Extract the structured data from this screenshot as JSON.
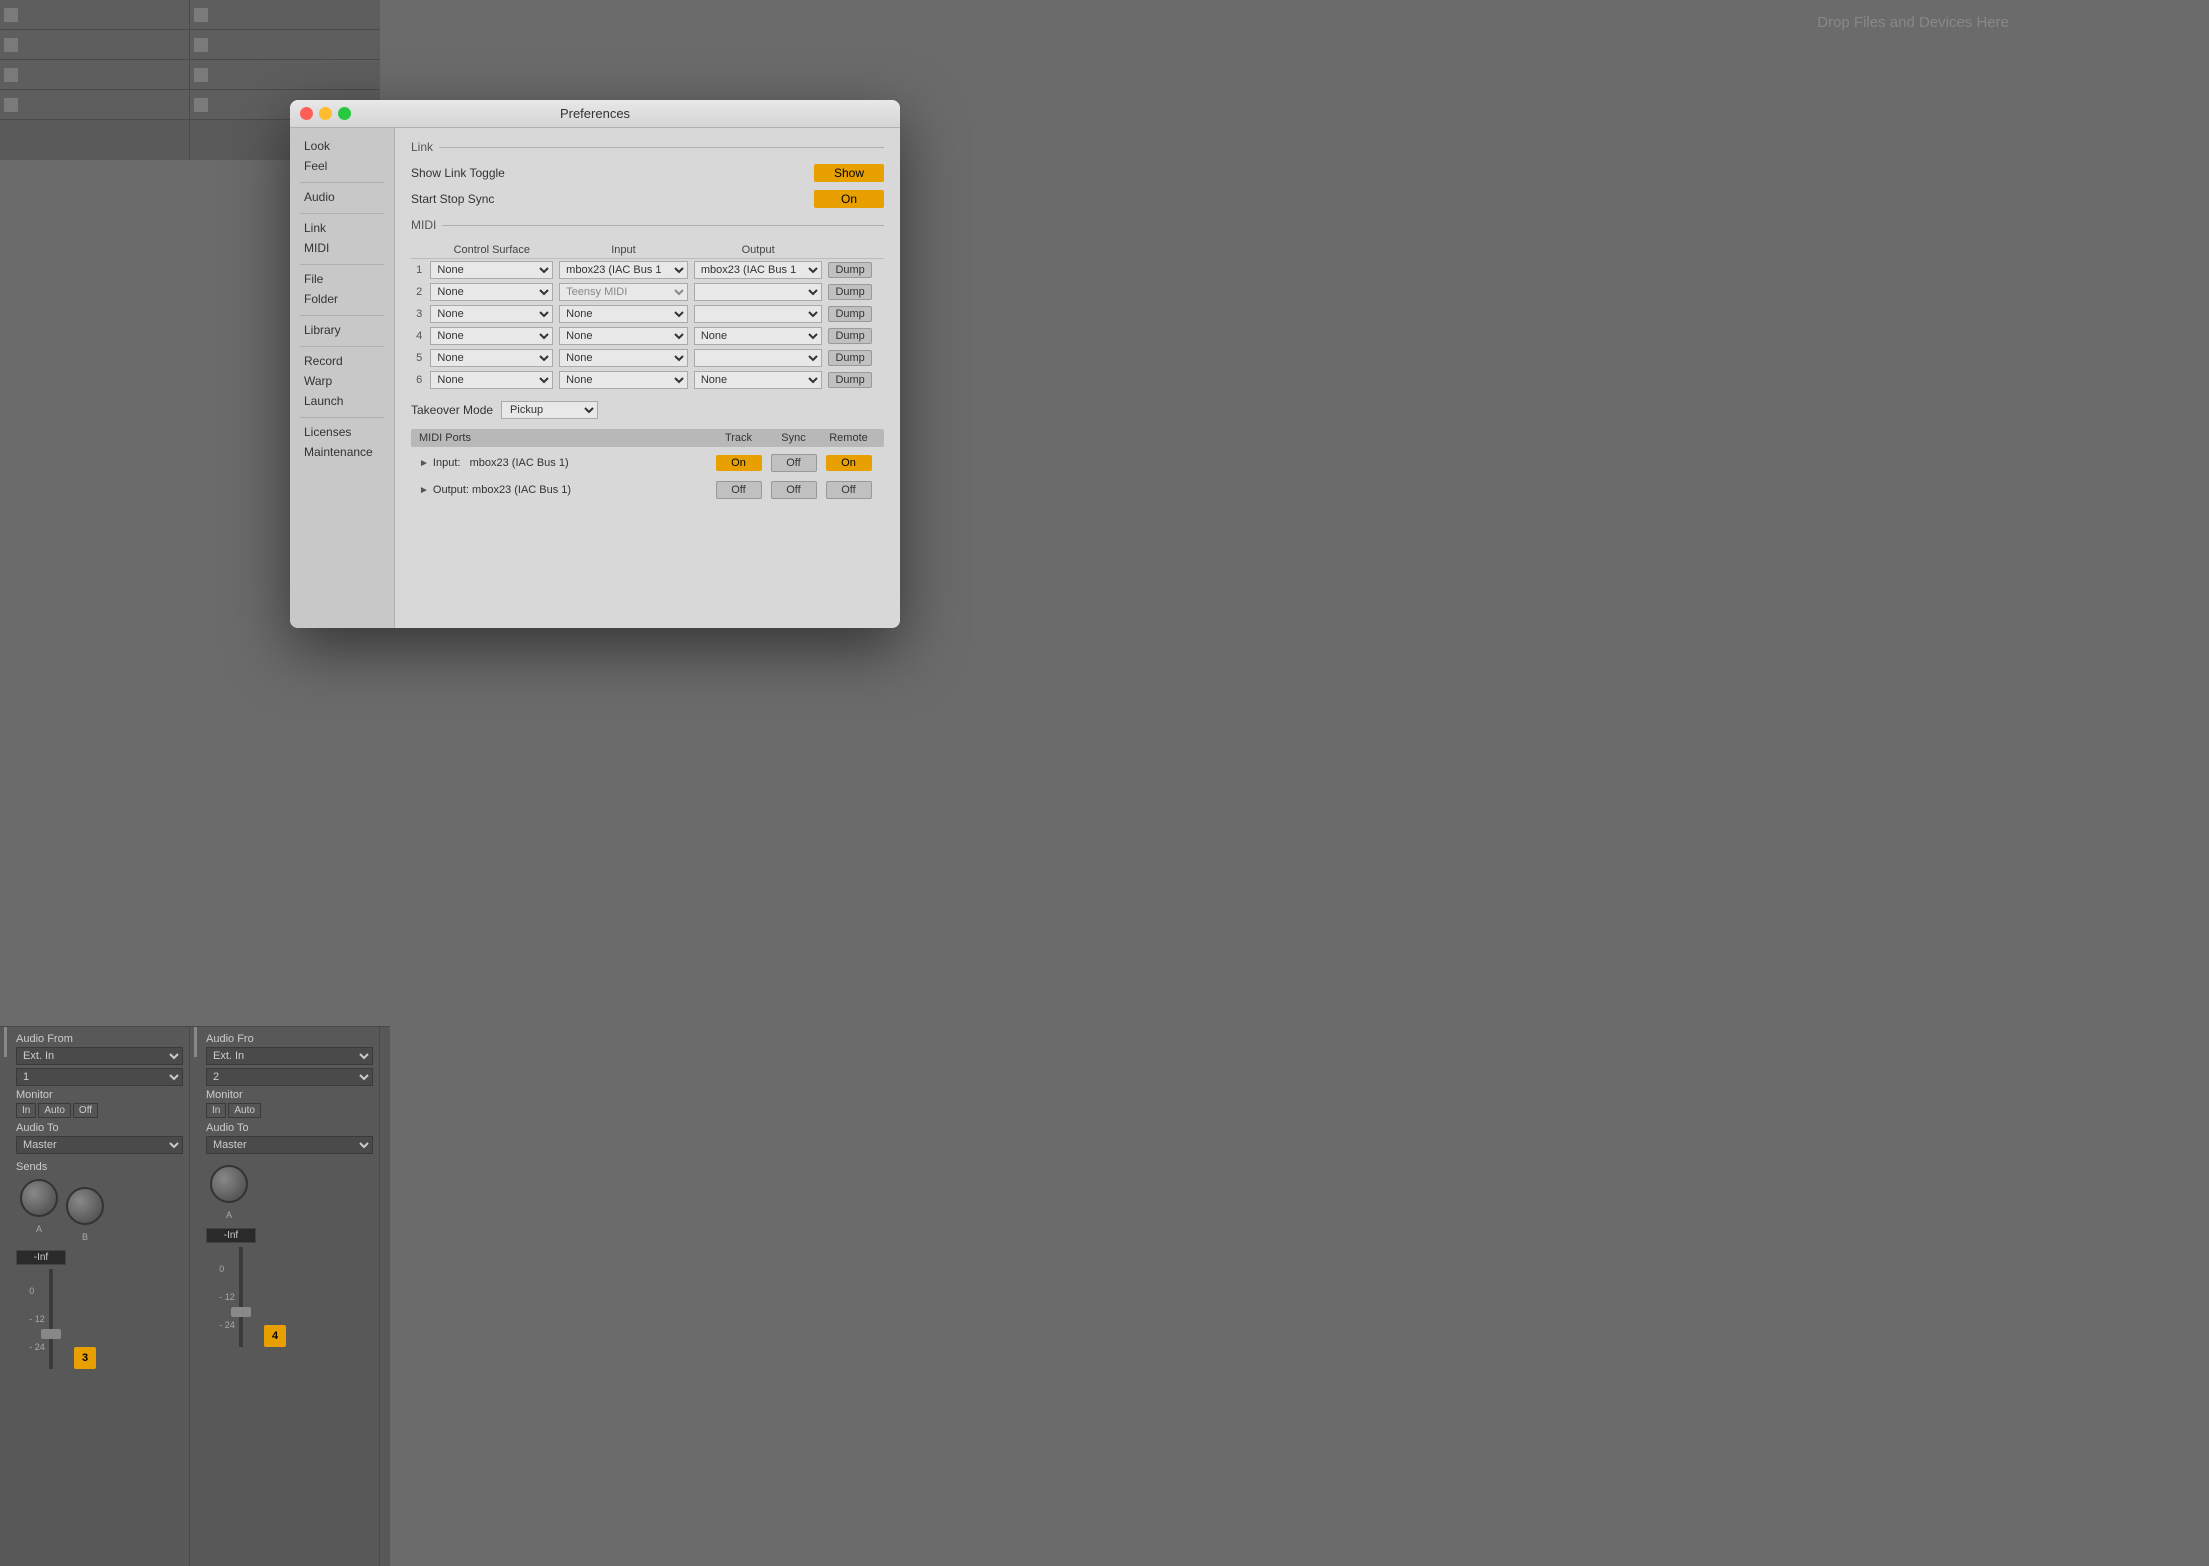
{
  "app": {
    "drop_zone_text": "Drop Files and Devices Here"
  },
  "preferences": {
    "title": "Preferences",
    "window_buttons": {
      "close": "close",
      "minimize": "minimize",
      "maximize": "maximize"
    },
    "sidebar": {
      "items": [
        {
          "id": "look",
          "label": "Look"
        },
        {
          "id": "feel",
          "label": "Feel"
        },
        {
          "id": "audio",
          "label": "Audio"
        },
        {
          "id": "link",
          "label": "Link"
        },
        {
          "id": "midi",
          "label": "MIDI"
        },
        {
          "id": "file",
          "label": "File"
        },
        {
          "id": "folder",
          "label": "Folder"
        },
        {
          "id": "library",
          "label": "Library"
        },
        {
          "id": "record",
          "label": "Record"
        },
        {
          "id": "warp",
          "label": "Warp"
        },
        {
          "id": "launch",
          "label": "Launch"
        },
        {
          "id": "licenses",
          "label": "Licenses"
        },
        {
          "id": "maintenance",
          "label": "Maintenance"
        }
      ]
    },
    "content": {
      "link_section_label": "Link",
      "show_link_toggle_label": "Show Link Toggle",
      "show_link_toggle_value": "Show",
      "start_stop_sync_label": "Start Stop Sync",
      "start_stop_sync_value": "On",
      "midi_section_label": "MIDI",
      "midi_table": {
        "headers": [
          "Control Surface",
          "Input",
          "Output",
          ""
        ],
        "rows": [
          {
            "num": "1",
            "surface": "None",
            "input": "mbox23 (IAC Bus 1",
            "output": "mbox23 (IAC Bus 1",
            "dump": "Dump"
          },
          {
            "num": "2",
            "surface": "None",
            "input": "Teensy MIDI",
            "output": "",
            "dump": "Dump"
          },
          {
            "num": "3",
            "surface": "None",
            "input": "None",
            "output": "",
            "dump": "Dump"
          },
          {
            "num": "4",
            "surface": "None",
            "input": "None",
            "output": "None",
            "dump": "Dump"
          },
          {
            "num": "5",
            "surface": "None",
            "input": "None",
            "output": "",
            "dump": "Dump"
          },
          {
            "num": "6",
            "surface": "None",
            "input": "None",
            "output": "None",
            "dump": "Dump"
          }
        ]
      },
      "takeover_mode_label": "Takeover Mode",
      "takeover_mode_value": "Pickup",
      "midi_ports": {
        "header_cols": [
          "MIDI Ports",
          "Track",
          "Sync",
          "Remote"
        ],
        "rows": [
          {
            "direction": "Input:",
            "name": "mbox23 (IAC Bus 1)",
            "track": "On",
            "track_active": true,
            "sync": "Off",
            "sync_active": false,
            "remote": "On",
            "remote_active": true
          },
          {
            "direction": "Output:",
            "name": "mbox23 (IAC Bus 1)",
            "track": "Off",
            "track_active": false,
            "sync": "Off",
            "sync_active": false,
            "remote": "Off",
            "remote_active": false
          }
        ]
      }
    }
  },
  "channel_strips": [
    {
      "id": 1,
      "audio_from_label": "Audio From",
      "audio_from_value": "Ext. In",
      "channel_value": "1",
      "monitor_label": "Monitor",
      "monitor_btns": [
        "In",
        "Auto",
        "Off"
      ],
      "audio_to_label": "Audio To",
      "audio_to_value": "Master",
      "sends_label": "Sends",
      "knob_a_label": "A",
      "knob_b_label": "B",
      "volume": "-Inf",
      "track_number": "3"
    },
    {
      "id": 2,
      "audio_from_label": "Audio Fro",
      "audio_from_value": "Ext. In",
      "channel_value": "2",
      "monitor_label": "Monitor",
      "monitor_btns": [
        "In",
        "Auto"
      ],
      "audio_to_label": "Audio To",
      "audio_to_value": "Master",
      "sends_label": "",
      "knob_a_label": "A",
      "volume": "-Inf",
      "track_number": "4"
    }
  ]
}
